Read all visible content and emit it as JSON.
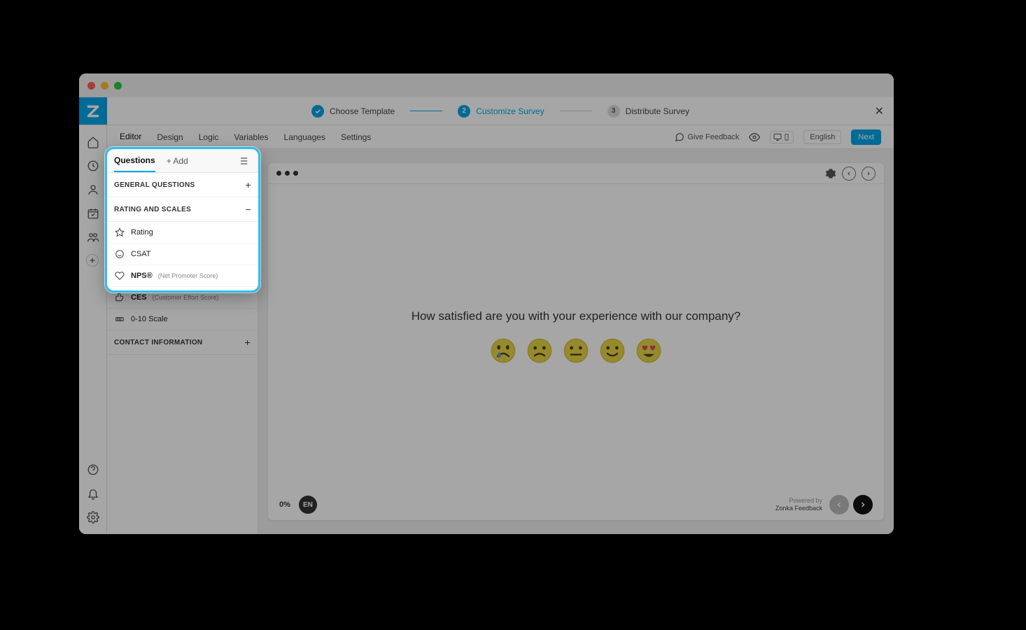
{
  "wizard": {
    "steps": [
      {
        "label": "Choose Template",
        "state": "done",
        "num": "✓"
      },
      {
        "label": "Customize Survey",
        "state": "current",
        "num": "2"
      },
      {
        "label": "Distribute Survey",
        "state": "pending",
        "num": "3"
      }
    ]
  },
  "subtabs": {
    "items": [
      "Editor",
      "Design",
      "Logic",
      "Variables",
      "Languages",
      "Settings"
    ],
    "active": "Editor",
    "feedback_label": "Give Feedback",
    "language_label": "English",
    "next_label": "Next"
  },
  "panel": {
    "tab_questions": "Questions",
    "tab_add": "Add",
    "sections": {
      "general": {
        "title": "GENERAL QUESTIONS",
        "collapsed": true
      },
      "rating": {
        "title": "RATING AND SCALES",
        "collapsed": false,
        "items": [
          {
            "label": "Rating",
            "icon": "star"
          },
          {
            "label": "CSAT",
            "icon": "face"
          },
          {
            "label": "NPS®",
            "sub": "(Net Promoter Score)",
            "icon": "heart"
          },
          {
            "label": "CES",
            "sub": "(Customer Effort Score)",
            "icon": "thumb"
          },
          {
            "label": "0-10 Scale",
            "icon": "scale"
          }
        ]
      },
      "contact": {
        "title": "CONTACT INFORMATION",
        "collapsed": true
      }
    }
  },
  "preview": {
    "question": "How satisfied are you with your experience with our company?",
    "progress": "0%",
    "lang_badge": "EN",
    "powered_top": "Powered by",
    "powered_bottom": "Zonka Feedback"
  }
}
